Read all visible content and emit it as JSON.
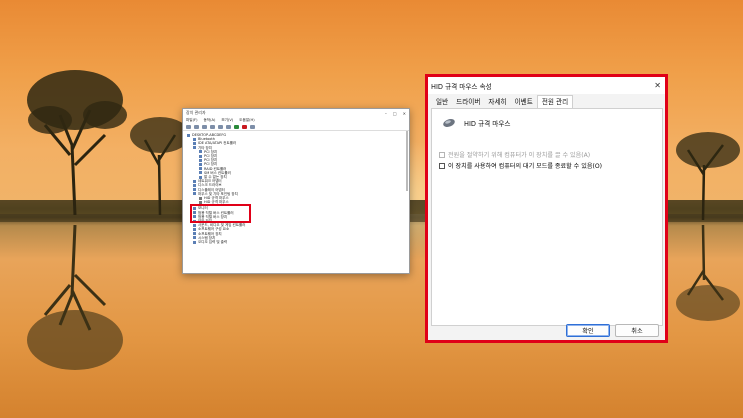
{
  "device_manager": {
    "title": "장치 관리자",
    "menu": [
      "파일(F)",
      "동작(A)",
      "보기(V)",
      "도움말(H)"
    ],
    "tree": [
      "DESKTOP-ABCDEFG",
      "Bluetooth",
      "IDE ATA/ATAPI 컨트롤러",
      "기타 장치",
      "PCI 장치",
      "PCI 장치",
      "PCI 장치",
      "PCI 장치",
      "RAID 컨트롤러",
      "SM 버스 컨트롤러",
      "알 수 없는 장치",
      "네트워크 어댑터",
      "디스크 드라이브",
      "디스플레이 어댑터",
      "마우스 및 기타 포인팅 장치",
      "HID 규격 마우스",
      "HID 규격 마우스",
      "모니터",
      "범용 직렬 버스 컨트롤러",
      "범용 직렬 버스 장치",
      "보안 장치",
      "사운드, 비디오 및 게임 컨트롤러",
      "소프트웨어 구성 요소",
      "소프트웨어 장치",
      "시스템 장치",
      "오디오 입력 및 출력"
    ]
  },
  "dialog": {
    "title": "HID 규격 마우스 속성",
    "tabs": [
      "일반",
      "드라이버",
      "자세히",
      "이벤트",
      "전원 관리"
    ],
    "active_tab": "전원 관리",
    "device_name": "HID 규격 마우스",
    "option_disabled": "전원을 절약하기 위해 컴퓨터가 이 장치를 끌 수 있음(A)",
    "option_wake": "이 장치를 사용하여 컴퓨터의 대기 모드를 종료할 수 있음(O)",
    "ok_label": "확인",
    "cancel_label": "취소",
    "close_glyph": "✕"
  },
  "colors": {
    "highlight": "#e00018",
    "accent": "#2f6fd6"
  }
}
